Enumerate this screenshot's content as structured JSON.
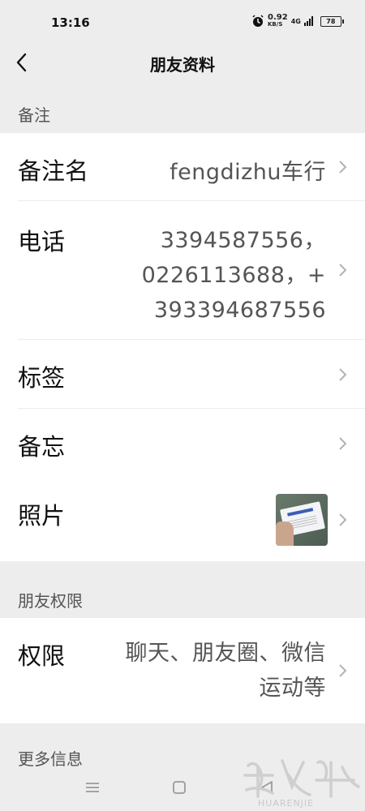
{
  "status_bar": {
    "time": "13:16",
    "net_speed": "0.92",
    "net_unit": "KB/S",
    "network": "4G",
    "battery": "78"
  },
  "header": {
    "title": "朋友资料"
  },
  "sections": {
    "remark": {
      "title": "备注",
      "rows": {
        "name": {
          "label": "备注名",
          "value": "fengdizhu车行"
        },
        "phone": {
          "label": "电话",
          "lines": [
            "3394587556，",
            "0226113688，+",
            "393394687556"
          ]
        },
        "tags": {
          "label": "标签"
        },
        "memo": {
          "label": "备忘"
        },
        "photo": {
          "label": "照片"
        }
      }
    },
    "permission": {
      "title": "朋友权限",
      "rows": {
        "perm": {
          "label": "权限",
          "lines": [
            "聊天、朋友圈、微信",
            "运动等"
          ]
        }
      }
    },
    "more": {
      "title": "更多信息"
    }
  },
  "watermark": {
    "text": "HUARENJIE"
  }
}
